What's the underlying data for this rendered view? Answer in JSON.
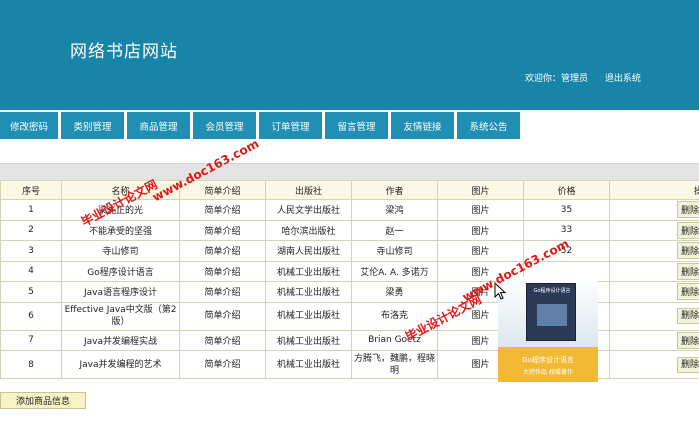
{
  "header": {
    "site_title": "网络书店网站",
    "welcome": "欢迎你：管理员",
    "logout": "退出系统"
  },
  "nav": {
    "tabs": [
      "修改密码",
      "类别管理",
      "商品管理",
      "会员管理",
      "订单管理",
      "留言管理",
      "友情链接",
      "系统公告"
    ]
  },
  "table": {
    "columns": [
      "序号",
      "名称",
      "简单介绍",
      "出版社",
      "作者",
      "图片",
      "价格",
      "操"
    ],
    "rows": [
      {
        "no": "1",
        "name": "梁光正的光",
        "intro": "简单介绍",
        "publisher": "人民文学出版社",
        "author": "梁鸿",
        "image": "图片",
        "price": "35"
      },
      {
        "no": "2",
        "name": "不能承受的坚强",
        "intro": "简单介绍",
        "publisher": "哈尔滨出版社",
        "author": "赵一",
        "image": "图片",
        "price": "33"
      },
      {
        "no": "3",
        "name": "寺山修司",
        "intro": "简单介绍",
        "publisher": "湖南人民出版社",
        "author": "寺山修司",
        "image": "图片",
        "price": "52"
      },
      {
        "no": "4",
        "name": "Go程序设计语言",
        "intro": "简单介绍",
        "publisher": "机械工业出版社",
        "author": "艾伦A. A. 多诺万",
        "image": "图片",
        "price": ""
      },
      {
        "no": "5",
        "name": "Java语言程序设计",
        "intro": "简单介绍",
        "publisher": "机械工业出版社",
        "author": "梁勇",
        "image": "图片",
        "price": ""
      },
      {
        "no": "6",
        "name": "Effective Java中文版（第2版）",
        "intro": "简单介绍",
        "publisher": "机械工业出版社",
        "author": "布洛克",
        "image": "图片",
        "price": ""
      },
      {
        "no": "7",
        "name": "Java并发编程实战",
        "intro": "简单介绍",
        "publisher": "机械工业出版社",
        "author": "Brian Goetz",
        "image": "图片",
        "price": ""
      },
      {
        "no": "8",
        "name": "Java并发编程的艺术",
        "intro": "简单介绍",
        "publisher": "机械工业出版社",
        "author": "方腾飞，魏鹏，程晓明",
        "image": "图片",
        "price": ""
      }
    ],
    "delete_label": "删除"
  },
  "add_button": "添加商品信息",
  "popup_cover": {
    "book_title": "Go程序设计语言",
    "line1": "Go程序设计语言",
    "line2": "大师作品 权威著作"
  },
  "watermarks": [
    {
      "text": "毕业设计论文网"
    },
    {
      "text": "www.doc163.com"
    }
  ],
  "colors": {
    "header_bg": "#1885a8",
    "nav_tab_bg": "#1f8fb4",
    "table_header_bg": "#fbf9e6",
    "watermark": "#e01818"
  }
}
